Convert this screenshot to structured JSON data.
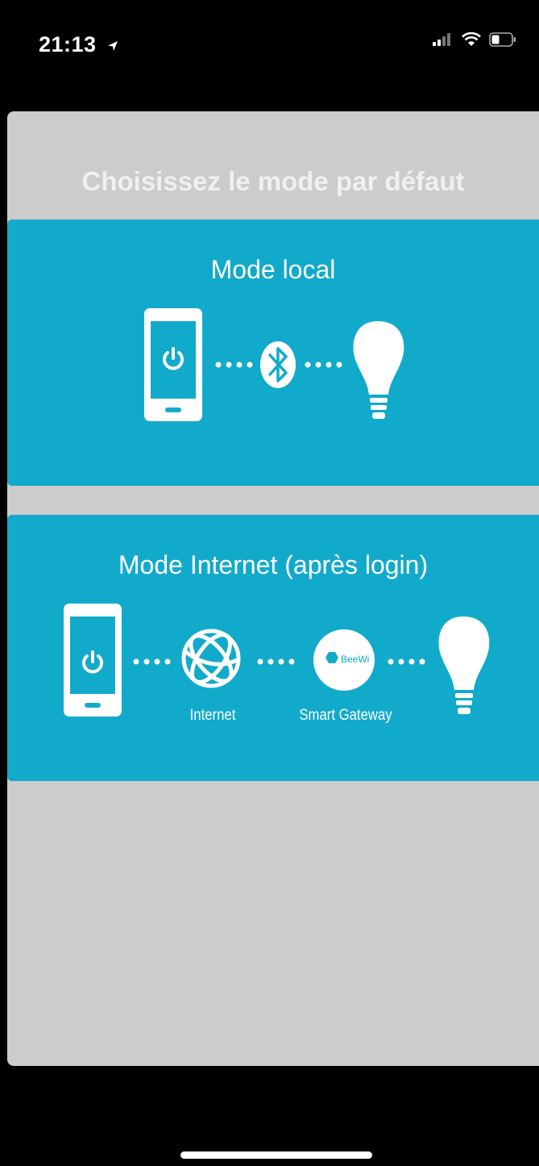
{
  "status_bar": {
    "time": "21:13",
    "icons": [
      "location-arrow-icon",
      "signal-icon",
      "wifi-icon",
      "battery-icon"
    ]
  },
  "screen": {
    "title": "Choisissez le mode par défaut"
  },
  "modes": [
    {
      "title": "Mode local",
      "diagram": [
        "phone-power-icon",
        "bluetooth-icon",
        "light-bulb-icon"
      ]
    },
    {
      "title": "Mode Internet (après login)",
      "diagram": [
        "phone-power-icon",
        "globe-icon",
        "beewi-gateway-icon",
        "light-bulb-icon"
      ],
      "captions": {
        "internet": "Internet",
        "gateway": "Smart Gateway"
      },
      "gateway_logo": "BeeWi"
    }
  ],
  "colors": {
    "card": "#12aacb",
    "sheet": "#cccccc",
    "background": "#000000",
    "text": "#ffffff"
  }
}
